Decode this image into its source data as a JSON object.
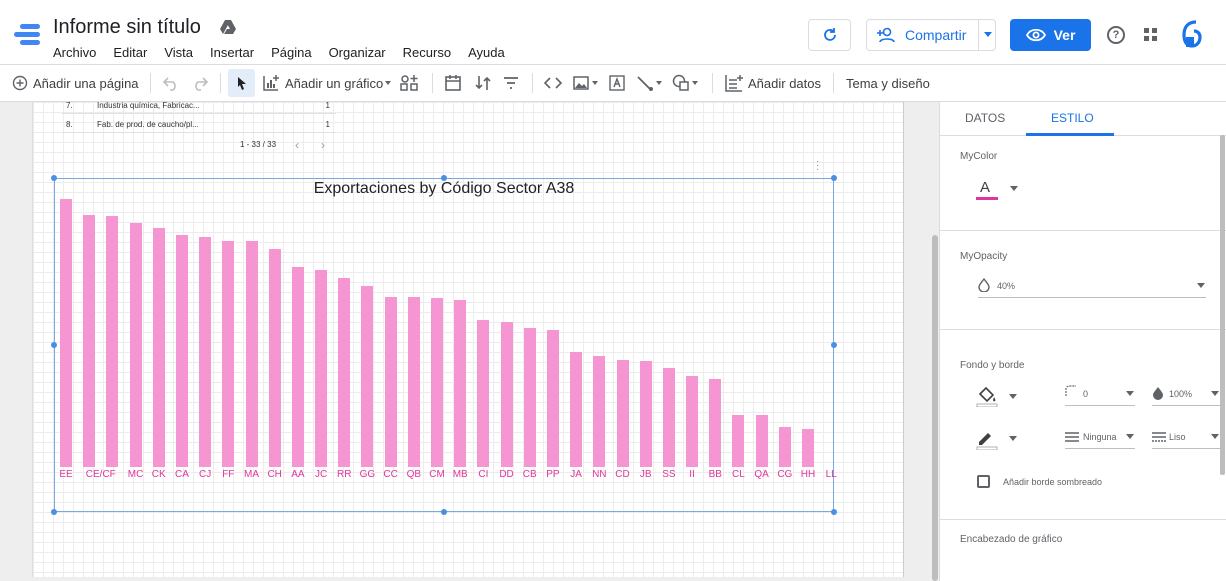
{
  "app": {
    "title": "Informe sin título",
    "menu": [
      "Archivo",
      "Editar",
      "Vista",
      "Insertar",
      "Página",
      "Organizar",
      "Recurso",
      "Ayuda"
    ],
    "share_label": "Compartir",
    "view_label": "Ver",
    "help_glyph": "?"
  },
  "toolbar": {
    "add_page": "Añadir una página",
    "add_chart": "Añadir un gráfico",
    "add_data": "Añadir datos",
    "theme": "Tema y diseño"
  },
  "table": {
    "rows": [
      {
        "n": "7.",
        "t": "Industria química, Fabricac...",
        "v": "1"
      },
      {
        "n": "8.",
        "t": "Fab. de prod. de caucho/pl...",
        "v": "1"
      }
    ],
    "pager": "1 - 33 / 33"
  },
  "chart_data": {
    "type": "bar",
    "title": "Exportaciones by Código Sector A38",
    "categories": [
      "EE",
      "CE",
      "CF",
      "MC",
      "CK",
      "CA",
      "CJ",
      "FF",
      "MA",
      "CH",
      "AA",
      "JC",
      "RR",
      "GG",
      "CC",
      "QB",
      "CM",
      "MB",
      "CI",
      "DD",
      "CB",
      "PP",
      "JA",
      "NN",
      "CD",
      "JB",
      "SS",
      "II",
      "BB",
      "CL",
      "QA",
      "CG",
      "HH",
      "LL"
    ],
    "category_labels": [
      "EE",
      "CE/CF",
      "MC",
      "CK",
      "CA",
      "CJ",
      "FF",
      "MA",
      "CH",
      "AA",
      "JC",
      "RR",
      "GG",
      "CC",
      "QB",
      "CM",
      "MB",
      "CI",
      "DD",
      "CB",
      "PP",
      "JA",
      "NN",
      "CD",
      "JB",
      "SS",
      "II",
      "BB",
      "CL",
      "QA",
      "CG",
      "HH",
      "LL"
    ],
    "values": [
      100,
      94,
      93.5,
      91,
      89,
      86.5,
      86,
      84.5,
      84.5,
      81.5,
      74.5,
      73.5,
      70.5,
      67.5,
      63.5,
      63.5,
      63,
      62.5,
      55,
      54,
      52,
      51,
      43,
      41.5,
      40,
      39.5,
      37,
      34,
      33,
      19.5,
      19.5,
      15,
      14
    ],
    "bar_color": "#f595d2",
    "label_color": "#e0359c"
  },
  "panel": {
    "tabs": [
      "DATOS",
      "ESTILO"
    ],
    "active_tab": "ESTILO",
    "mycolor_label": "MyColor",
    "color_glyph": "A",
    "color_value": "#e0359c",
    "myopacity_label": "MyOpacity",
    "opacity_value": "40%",
    "fondo_label": "Fondo y borde",
    "radius_value": "0",
    "opacity2_value": "100%",
    "border_weight": "Ninguna",
    "border_style": "Liso",
    "shadow_label": "Añadir borde sombreado",
    "header_label": "Encabezado de gráfico"
  },
  "colors": {
    "accent": "#1a73e8"
  }
}
